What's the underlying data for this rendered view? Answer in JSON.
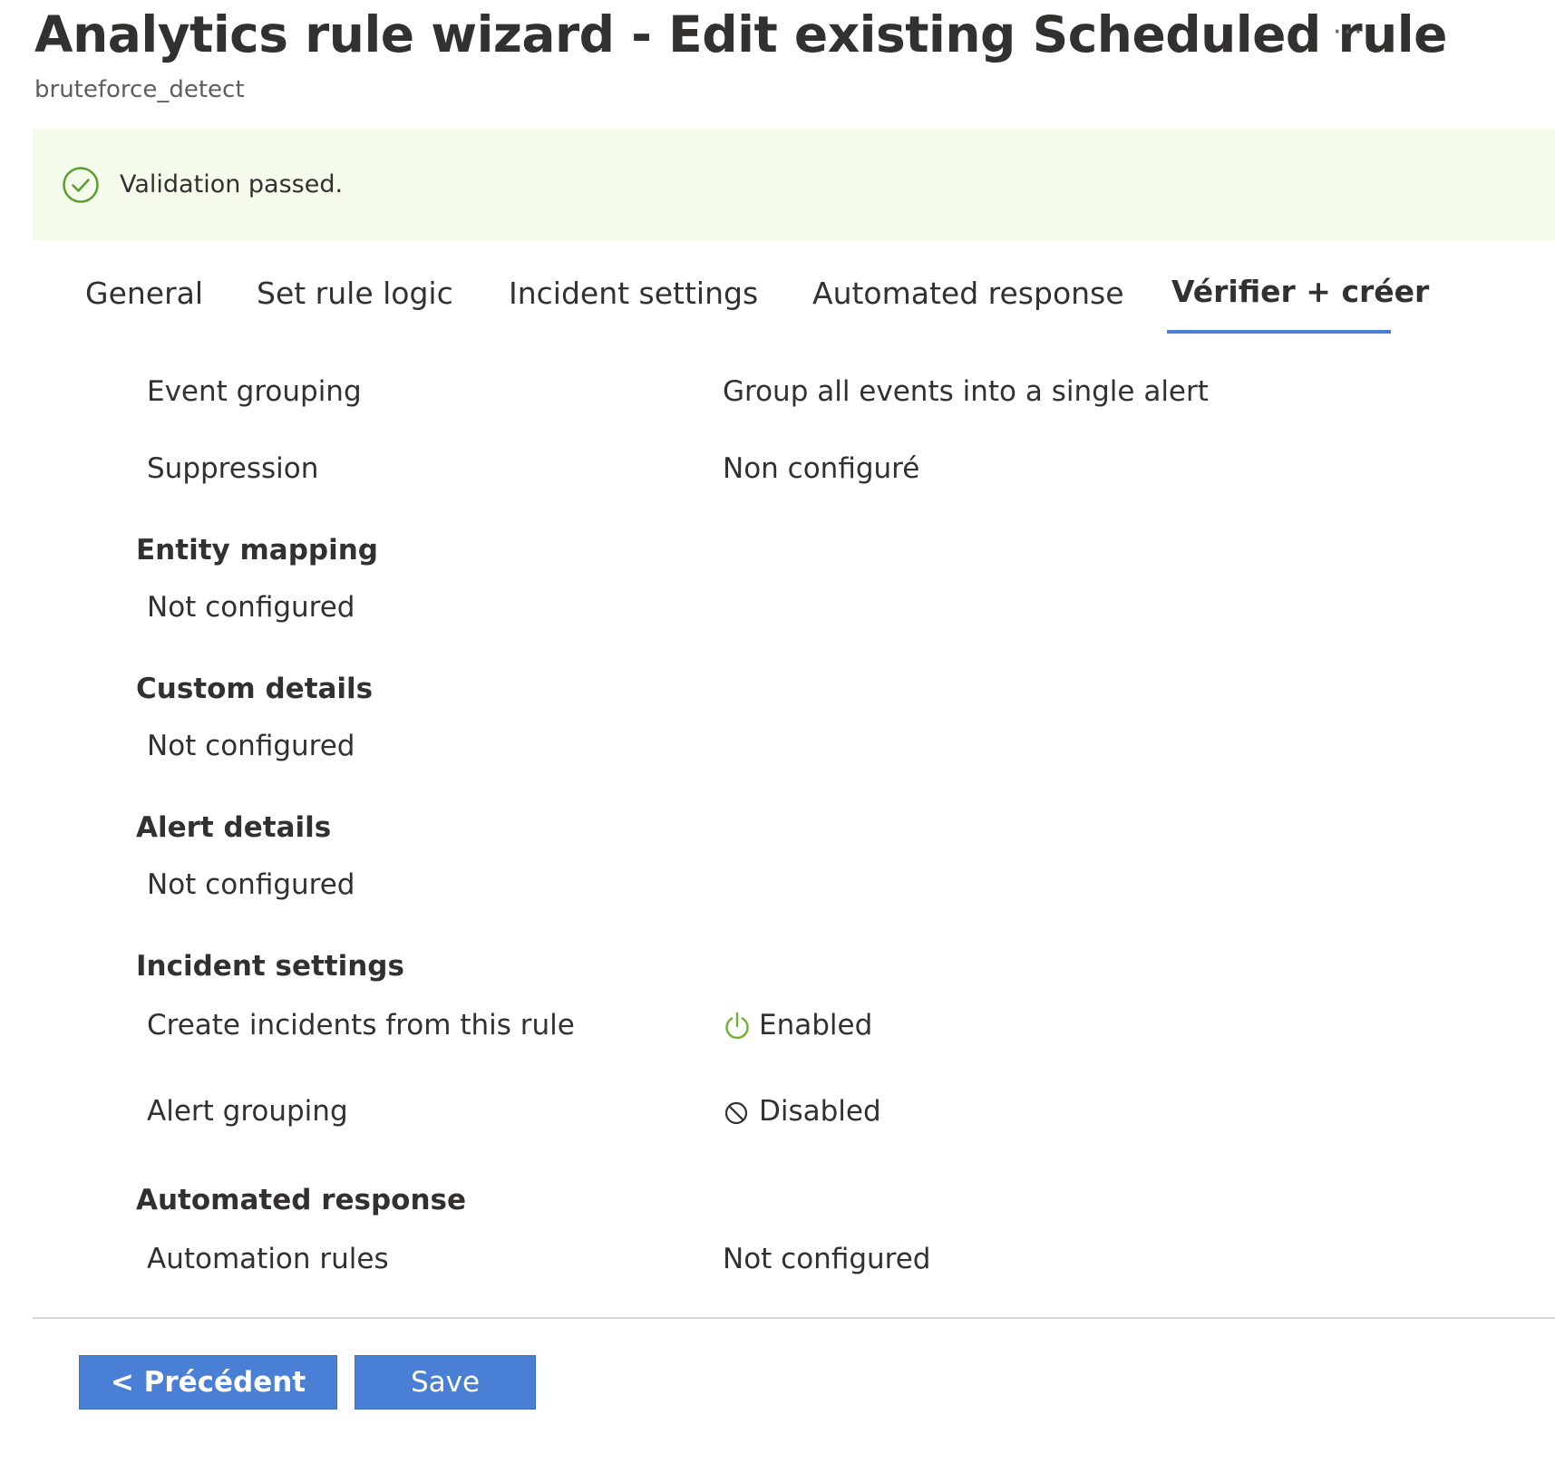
{
  "header": {
    "title": "Analytics rule wizard - Edit existing Scheduled rule",
    "more": "···",
    "subtitle": "bruteforce_detect"
  },
  "banner": {
    "text": "Validation passed.",
    "icon": "check-circle-icon",
    "color": "#5a9e2f",
    "background": "#f5fbea"
  },
  "tabs": [
    {
      "label": "General"
    },
    {
      "label": "Set rule logic"
    },
    {
      "label": "Incident settings"
    },
    {
      "label": "Automated response"
    },
    {
      "label": "Vérifier + créer",
      "active": true
    }
  ],
  "rows": {
    "event_grouping": {
      "label": "Event grouping",
      "value": "Group all events into a single alert"
    },
    "suppression": {
      "label": "Suppression",
      "value": "Non configuré"
    }
  },
  "sections": {
    "entity_mapping": {
      "title": "Entity mapping",
      "value": "Not configured"
    },
    "custom_details": {
      "title": "Custom details",
      "value": "Not configured"
    },
    "alert_details": {
      "title": "Alert details",
      "value": "Not configured"
    },
    "incident_settings": {
      "title": "Incident settings",
      "create_incidents": {
        "label": "Create incidents from this rule",
        "value": "Enabled",
        "icon": "power-icon",
        "icon_color": "#6bb02e"
      },
      "alert_grouping": {
        "label": "Alert grouping",
        "value": "Disabled",
        "icon": "blocked-icon",
        "icon_color": "#323130"
      }
    },
    "automated_response": {
      "title": "Automated response",
      "automation_rules": {
        "label": "Automation rules",
        "value": "Not configured"
      }
    }
  },
  "buttons": {
    "previous": "< Précédent",
    "save": "Save"
  },
  "colors": {
    "accent": "#4a7fd6",
    "text": "#323130",
    "subtle": "#605e5c"
  }
}
